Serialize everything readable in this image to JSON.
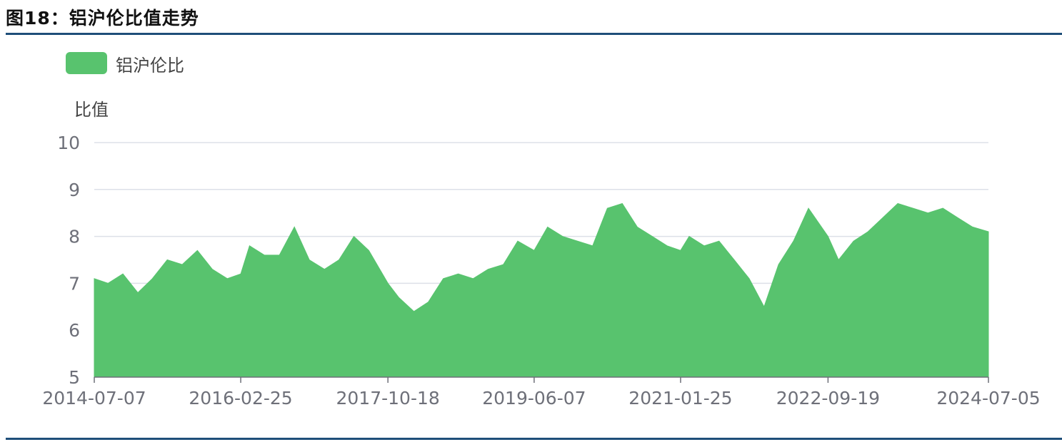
{
  "figure_title": "图18：铝沪伦比值走势",
  "colors": {
    "series": "#58c36e",
    "grid": "#dde0e8",
    "axis_text": "#6e7079",
    "rule": "#1e4e79"
  },
  "chart_data": {
    "type": "area",
    "title": "",
    "xlabel": "",
    "ylabel": "比值",
    "ylim": [
      5,
      10
    ],
    "yticks": [
      "5",
      "6",
      "7",
      "8",
      "9",
      "10"
    ],
    "xticks": [
      "2014-07-07",
      "2016-02-25",
      "2017-10-18",
      "2019-06-07",
      "2021-01-25",
      "2022-09-19",
      "2024-07-05"
    ],
    "legend": "top-left",
    "grid": true,
    "series": [
      {
        "name": "铝沪伦比",
        "x": [
          "2014-07-07",
          "2014-09-01",
          "2014-11-01",
          "2015-01-01",
          "2015-03-01",
          "2015-05-01",
          "2015-07-01",
          "2015-09-01",
          "2015-11-01",
          "2016-01-01",
          "2016-02-25",
          "2016-04-01",
          "2016-06-01",
          "2016-08-01",
          "2016-10-01",
          "2016-12-01",
          "2017-02-01",
          "2017-04-01",
          "2017-06-01",
          "2017-08-01",
          "2017-10-18",
          "2017-12-01",
          "2018-02-01",
          "2018-04-01",
          "2018-06-01",
          "2018-08-01",
          "2018-10-01",
          "2018-12-01",
          "2019-02-01",
          "2019-04-01",
          "2019-06-07",
          "2019-08-01",
          "2019-10-01",
          "2019-12-01",
          "2020-02-01",
          "2020-04-01",
          "2020-06-01",
          "2020-08-01",
          "2020-10-01",
          "2020-12-01",
          "2021-01-25",
          "2021-03-01",
          "2021-05-01",
          "2021-07-01",
          "2021-09-01",
          "2021-11-01",
          "2022-01-01",
          "2022-03-01",
          "2022-05-01",
          "2022-07-01",
          "2022-09-19",
          "2022-11-01",
          "2023-01-01",
          "2023-03-01",
          "2023-05-01",
          "2023-07-01",
          "2023-09-01",
          "2023-11-01",
          "2024-01-01",
          "2024-03-01",
          "2024-05-01",
          "2024-07-05"
        ],
        "values": [
          7.1,
          7.0,
          7.2,
          6.8,
          7.1,
          7.5,
          7.4,
          7.7,
          7.3,
          7.1,
          7.2,
          7.8,
          7.6,
          7.6,
          8.2,
          7.5,
          7.3,
          7.5,
          8.0,
          7.7,
          7.0,
          6.7,
          6.4,
          6.6,
          7.1,
          7.2,
          7.1,
          7.3,
          7.4,
          7.9,
          7.7,
          8.2,
          8.0,
          7.9,
          7.8,
          8.6,
          8.7,
          8.2,
          8.0,
          7.8,
          7.7,
          8.0,
          7.8,
          7.9,
          7.5,
          7.1,
          6.5,
          7.4,
          7.9,
          8.6,
          8.0,
          7.5,
          7.9,
          8.1,
          8.4,
          8.7,
          8.6,
          8.5,
          8.6,
          8.4,
          8.2,
          8.1
        ]
      }
    ]
  }
}
